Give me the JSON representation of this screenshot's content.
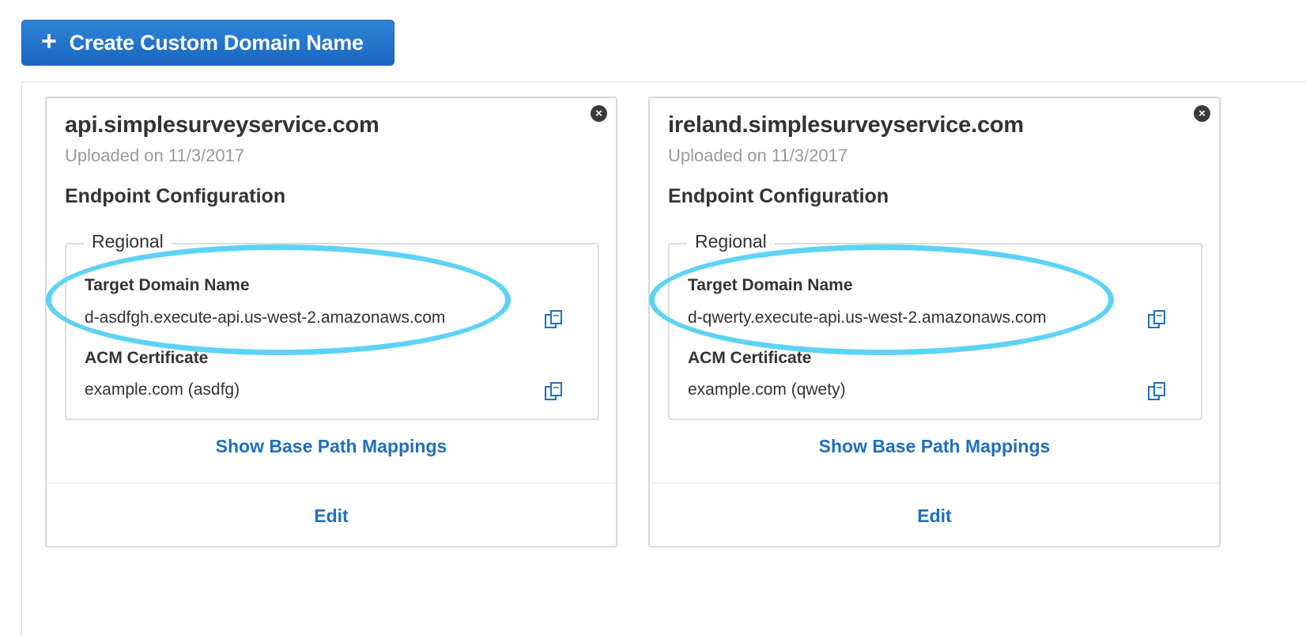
{
  "toolbar": {
    "create_label": "Create Custom Domain Name",
    "create_icon": "plus-icon"
  },
  "cards": [
    {
      "domain": "api.simplesurveyservice.com",
      "uploaded": "Uploaded on 11/3/2017",
      "endpoint_title": "Endpoint Configuration",
      "endpoint_type": "Regional",
      "target_label": "Target Domain Name",
      "target_value": "d-asdfgh.execute-api.us-west-2.amazonaws.com",
      "acm_label": "ACM Certificate",
      "acm_value": "example.com (asdfg)",
      "show_mappings": "Show Base Path Mappings",
      "edit": "Edit"
    },
    {
      "domain": "ireland.simplesurveyservice.com",
      "uploaded": "Uploaded on 11/3/2017",
      "endpoint_title": "Endpoint Configuration",
      "endpoint_type": "Regional",
      "target_label": "Target Domain Name",
      "target_value": "d-qwerty.execute-api.us-west-2.amazonaws.com",
      "acm_label": "ACM Certificate",
      "acm_value": "example.com (qwety)",
      "show_mappings": "Show Base Path Mappings",
      "edit": "Edit"
    }
  ],
  "colors": {
    "primary_button": "#1a66c0",
    "link": "#1f6fbf",
    "highlight_oval": "#5dd3f5"
  },
  "icons": {
    "close": "close-circle-icon",
    "copy": "copy-icon"
  }
}
